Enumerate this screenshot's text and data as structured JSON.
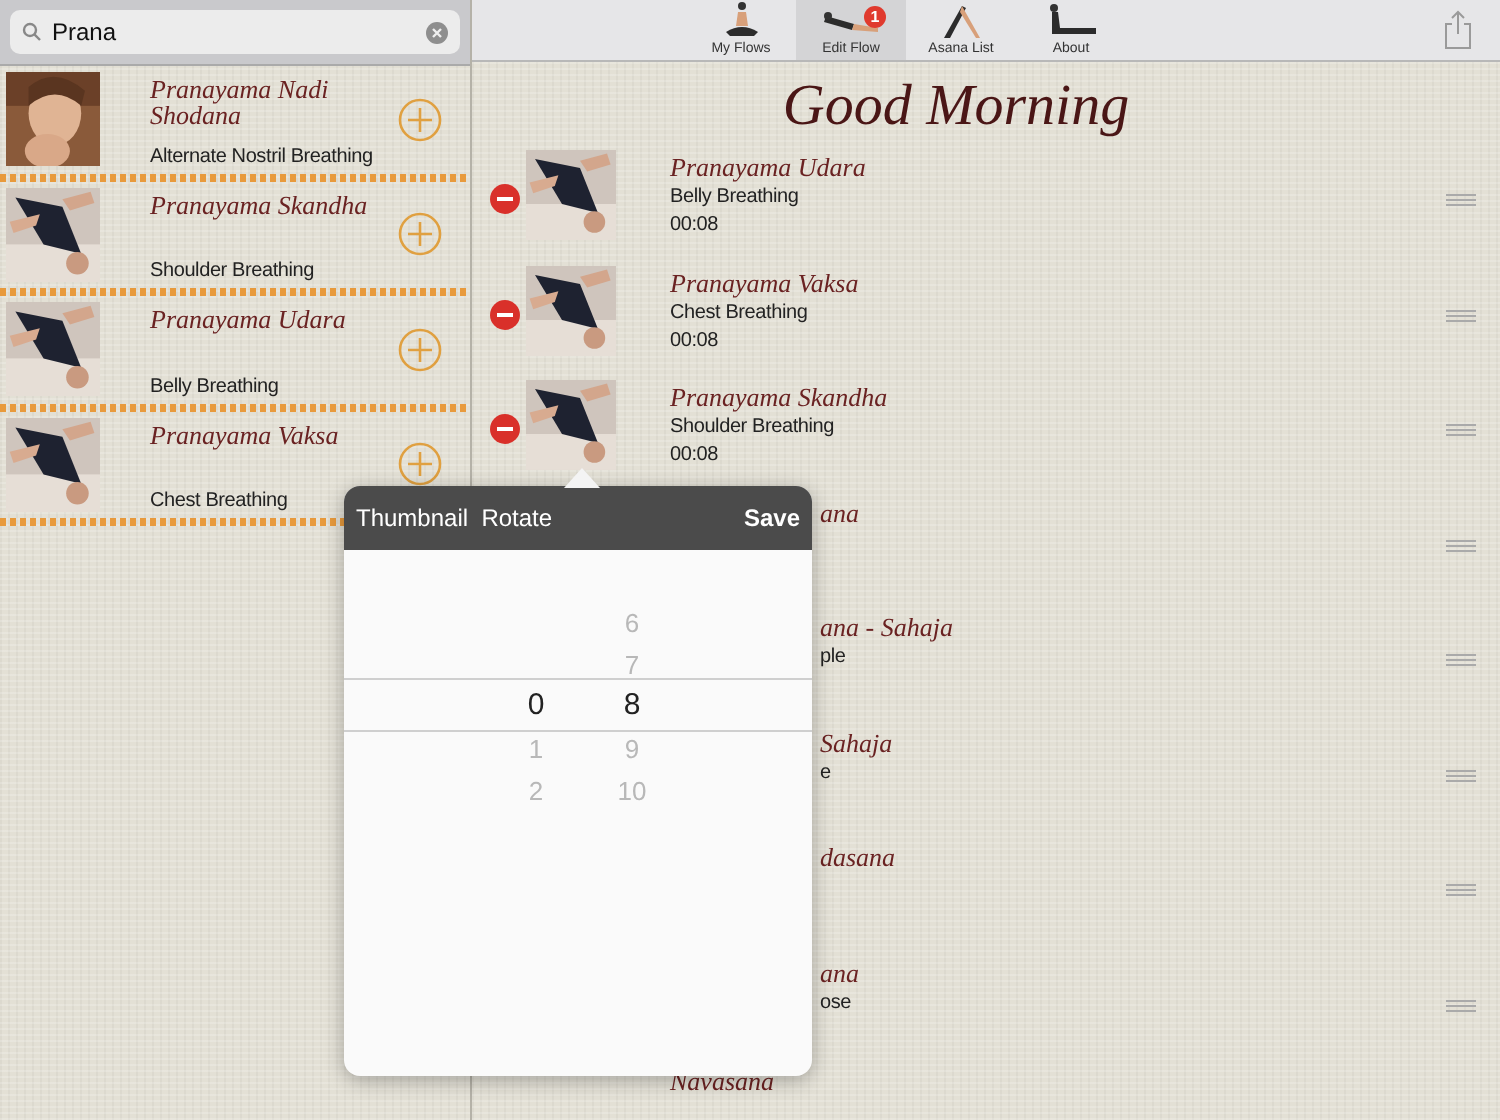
{
  "search": {
    "value": "Prana"
  },
  "asana_results": [
    {
      "title": "Pranayama Nadi Shodana",
      "subtitle": "Alternate Nostril Breathing"
    },
    {
      "title": "Pranayama Skandha",
      "subtitle": "Shoulder Breathing"
    },
    {
      "title": "Pranayama Udara",
      "subtitle": "Belly Breathing"
    },
    {
      "title": "Pranayama Vaksa",
      "subtitle": "Chest Breathing"
    }
  ],
  "toolbar": {
    "tabs": [
      {
        "label": "My Flows",
        "selected": false
      },
      {
        "label": "Edit Flow",
        "selected": true,
        "badge": "1"
      },
      {
        "label": "Asana List",
        "selected": false
      },
      {
        "label": "About",
        "selected": false
      }
    ]
  },
  "flow": {
    "title": "Good Morning",
    "items": [
      {
        "kind": "full",
        "title": "Pranayama Udara",
        "subtitle": "Belly Breathing",
        "duration": "00:08"
      },
      {
        "kind": "full",
        "title": "Pranayama Vaksa",
        "subtitle": "Chest Breathing",
        "duration": "00:08"
      },
      {
        "kind": "full",
        "title": "Pranayama Skandha",
        "subtitle": "Shoulder Breathing",
        "duration": "00:08"
      },
      {
        "kind": "covered",
        "title": "ana"
      },
      {
        "kind": "covered",
        "title": "ana - Sahaja",
        "subtitle": "ple"
      },
      {
        "kind": "covered",
        "title": "Sahaja",
        "subtitle": "e"
      },
      {
        "kind": "covered",
        "title": "dasana"
      },
      {
        "kind": "covered",
        "title": "ana",
        "subtitle": "ose"
      },
      {
        "kind": "cut",
        "title": "Navasana"
      }
    ]
  },
  "popover": {
    "title": "Thumbnail  Rotate",
    "save": "Save",
    "picker": [
      {
        "items": [
          {
            "label": "0",
            "selected": true
          },
          {
            "label": "1",
            "selected": false
          },
          {
            "label": "2",
            "selected": false
          }
        ]
      },
      {
        "items": [
          {
            "label": "6",
            "selected": false
          },
          {
            "label": "7",
            "selected": false
          },
          {
            "label": "8",
            "selected": true
          },
          {
            "label": "9",
            "selected": false
          },
          {
            "label": "10",
            "selected": false
          }
        ]
      }
    ]
  }
}
